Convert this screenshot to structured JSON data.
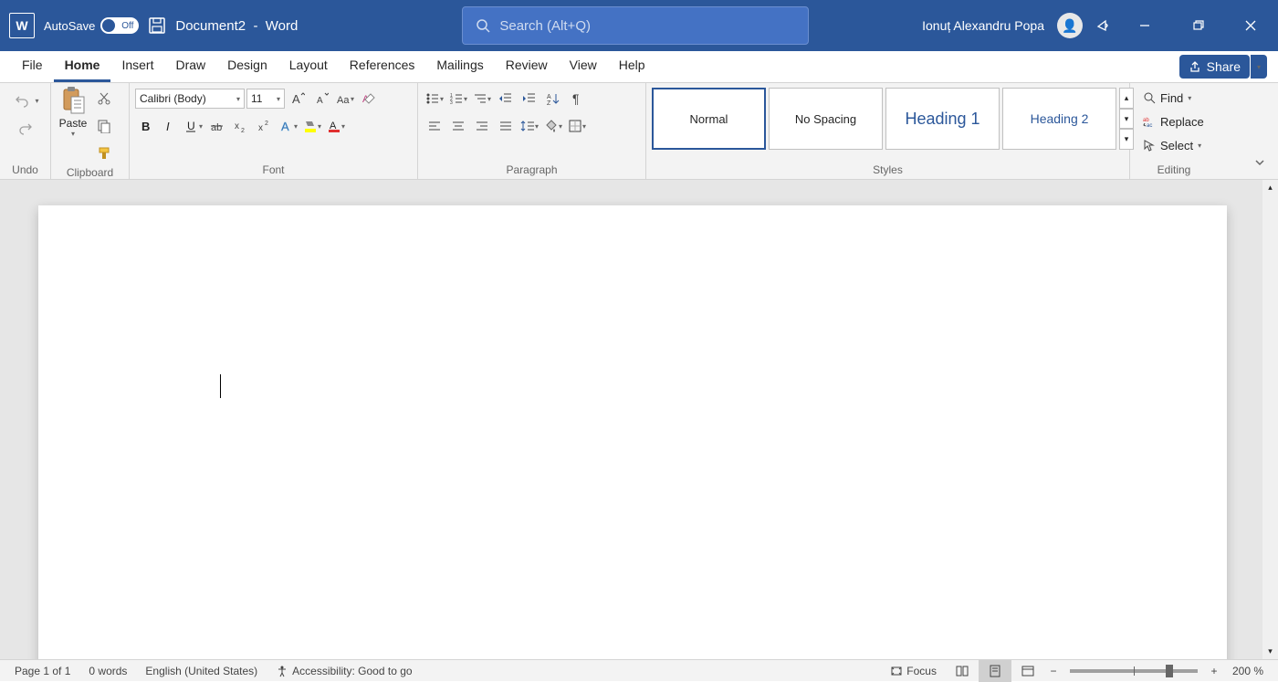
{
  "titlebar": {
    "autosave_label": "AutoSave",
    "autosave_state": "Off",
    "document_name": "Document2",
    "separator": "-",
    "app_name": "Word",
    "search_placeholder": "Search (Alt+Q)",
    "user_name": "Ionuț Alexandru Popa"
  },
  "tabs": {
    "items": [
      "File",
      "Home",
      "Insert",
      "Draw",
      "Design",
      "Layout",
      "References",
      "Mailings",
      "Review",
      "View",
      "Help"
    ],
    "active_index": 1,
    "share_label": "Share"
  },
  "ribbon": {
    "undo_group": "Undo",
    "clipboard_group": "Clipboard",
    "paste_label": "Paste",
    "font_group": "Font",
    "font_name": "Calibri (Body)",
    "font_size": "11",
    "paragraph_group": "Paragraph",
    "styles_group": "Styles",
    "styles": [
      "Normal",
      "No Spacing",
      "Heading 1",
      "Heading 2"
    ],
    "editing_group": "Editing",
    "find_label": "Find",
    "replace_label": "Replace",
    "select_label": "Select"
  },
  "statusbar": {
    "page_info": "Page 1 of 1",
    "word_count": "0 words",
    "language": "English (United States)",
    "accessibility": "Accessibility: Good to go",
    "focus_label": "Focus",
    "zoom_value": "200 %"
  }
}
